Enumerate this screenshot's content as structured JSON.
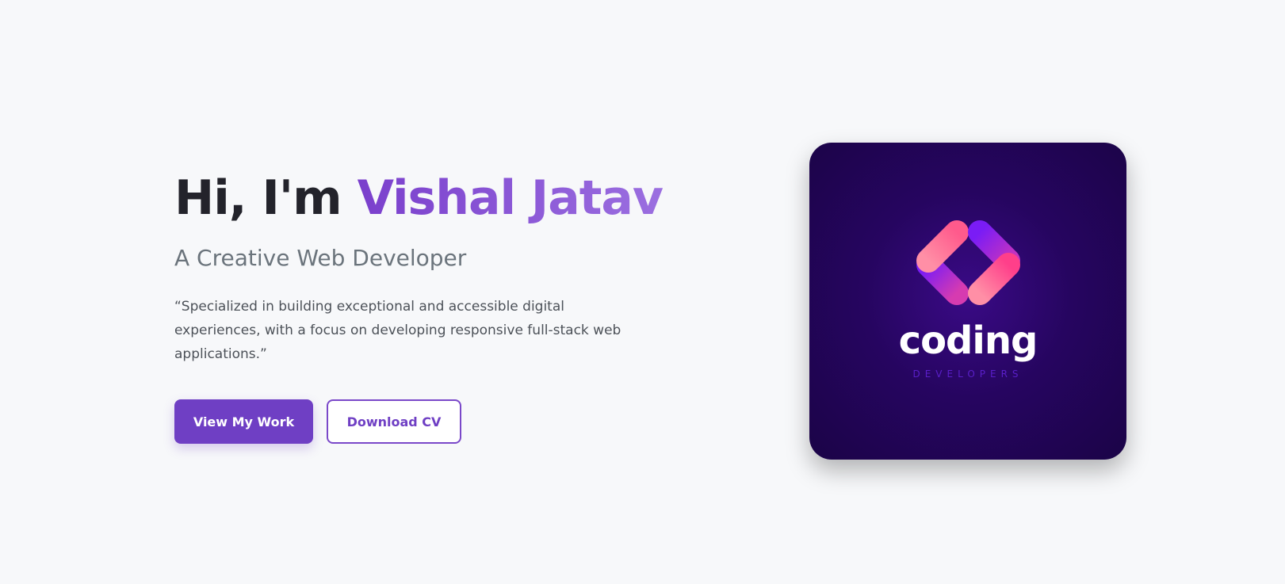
{
  "hero": {
    "greeting": "Hi, I'm ",
    "name": "Vishal Jatav",
    "subtitle": "A Creative Web Developer",
    "description": "“Specialized in building exceptional and accessible digital experiences, with a focus on developing responsive full-stack web applications.”",
    "buttons": {
      "primary_label": "View My Work",
      "secondary_label": "Download CV"
    }
  },
  "logo": {
    "icon": "code-brackets-icon",
    "word": "coding",
    "subword": "DEVELOPERS"
  },
  "colors": {
    "background": "#f7f8fa",
    "accent": "#6f3fc4",
    "name_gradient_start": "#7a3fcc",
    "name_gradient_end": "#9b6fe0",
    "card_bg": "#1b0447",
    "bracket_pink": "#ff6f9f",
    "bracket_purple": "#7a1cf5"
  }
}
